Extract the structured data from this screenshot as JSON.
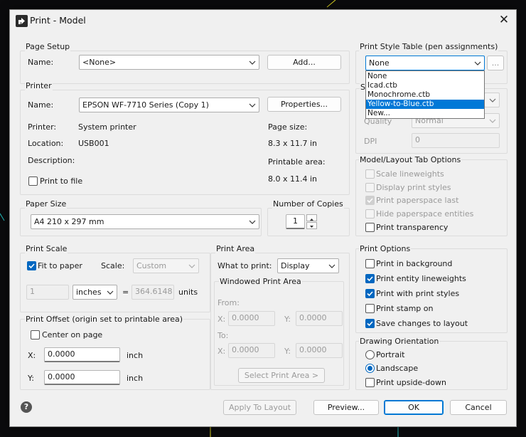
{
  "window": {
    "title": "Print - Model",
    "close_glyph": "✕"
  },
  "page_setup": {
    "group_label": "Page Setup",
    "name_label": "Name:",
    "name_value": "<None>",
    "add_button": "Add..."
  },
  "printer": {
    "group_label": "Printer",
    "name_label": "Name:",
    "name_value": "EPSON WF-7710 Series (Copy 1)",
    "properties_button": "Properties...",
    "printer_label": "Printer:",
    "printer_value": "System printer",
    "location_label": "Location:",
    "location_value": "USB001",
    "description_label": "Description:",
    "page_size_label": "Page size:",
    "page_size_value": "8.3 x 11.7 in",
    "printable_area_label": "Printable area:",
    "printable_area_value": "8.0 x 11.4 in",
    "print_to_file_label": "Print to file"
  },
  "paper_size": {
    "group_label": "Paper Size",
    "value": "A4 210 x 297 mm"
  },
  "copies": {
    "group_label": "Number of Copies",
    "value": "1"
  },
  "print_scale": {
    "group_label": "Print Scale",
    "fit_to_paper_label": "Fit to paper",
    "scale_label": "Scale:",
    "scale_value": "Custom",
    "num_value": "1",
    "unit_value": "inches",
    "equals": "=",
    "den_value": "364.6148",
    "units_label": "units"
  },
  "print_offset": {
    "group_label": "Print Offset (origin set to printable area)",
    "center_label": "Center on page",
    "x_label": "X:",
    "x_value": "0.0000",
    "x_unit": "inch",
    "y_label": "Y:",
    "y_value": "0.0000",
    "y_unit": "inch"
  },
  "print_area": {
    "group_label": "Print Area",
    "what_label": "What to print:",
    "what_value": "Display",
    "windowed_label": "Windowed Print Area",
    "from_label": "From:",
    "from_x_label": "X:",
    "from_x_value": "0.0000",
    "from_y_label": "Y:",
    "from_y_value": "0.0000",
    "to_label": "To:",
    "to_x_label": "X:",
    "to_x_value": "0.0000",
    "to_y_label": "Y:",
    "to_y_value": "0.0000",
    "select_button": "Select Print Area >"
  },
  "style_table": {
    "group_label": "Print Style Table (pen assignments)",
    "value": "None",
    "edit_button": "...",
    "options": [
      "None",
      "Icad.ctb",
      "Monochrome.ctb",
      "Yellow-to-Blue.ctb",
      "New..."
    ],
    "selected_option": "Yellow-to-Blue.ctb"
  },
  "shaded": {
    "group_label_fragment": "S",
    "quality_label": "Quality",
    "quality_value": "Normal",
    "dpi_label": "DPI",
    "dpi_value": "0"
  },
  "model_layout": {
    "group_label": "Model/Layout Tab Options",
    "options": [
      {
        "label": "Scale lineweights",
        "checked": false,
        "enabled": false
      },
      {
        "label": "Display print styles",
        "checked": false,
        "enabled": false
      },
      {
        "label": "Print paperspace last",
        "checked": true,
        "enabled": false
      },
      {
        "label": "Hide paperspace entities",
        "checked": false,
        "enabled": false
      },
      {
        "label": "Print transparency",
        "checked": false,
        "enabled": true
      }
    ]
  },
  "print_options": {
    "group_label": "Print Options",
    "options": [
      {
        "label": "Print in background",
        "checked": false
      },
      {
        "label": "Print entity lineweights",
        "checked": true
      },
      {
        "label": "Print with print styles",
        "checked": true
      },
      {
        "label": "Print stamp on",
        "checked": false
      },
      {
        "label": "Save changes to layout",
        "checked": true
      }
    ]
  },
  "orientation": {
    "group_label": "Drawing Orientation",
    "portrait_label": "Portrait",
    "landscape_label": "Landscape",
    "upside_down_label": "Print upside-down",
    "selected": "Landscape"
  },
  "footer": {
    "help_glyph": "?",
    "apply_button": "Apply To Layout",
    "preview_button": "Preview...",
    "ok_button": "OK",
    "cancel_button": "Cancel"
  },
  "colors": {
    "accent": "#0078d4",
    "selection": "#0078d7",
    "dialog_bg": "#f0f0f0"
  }
}
